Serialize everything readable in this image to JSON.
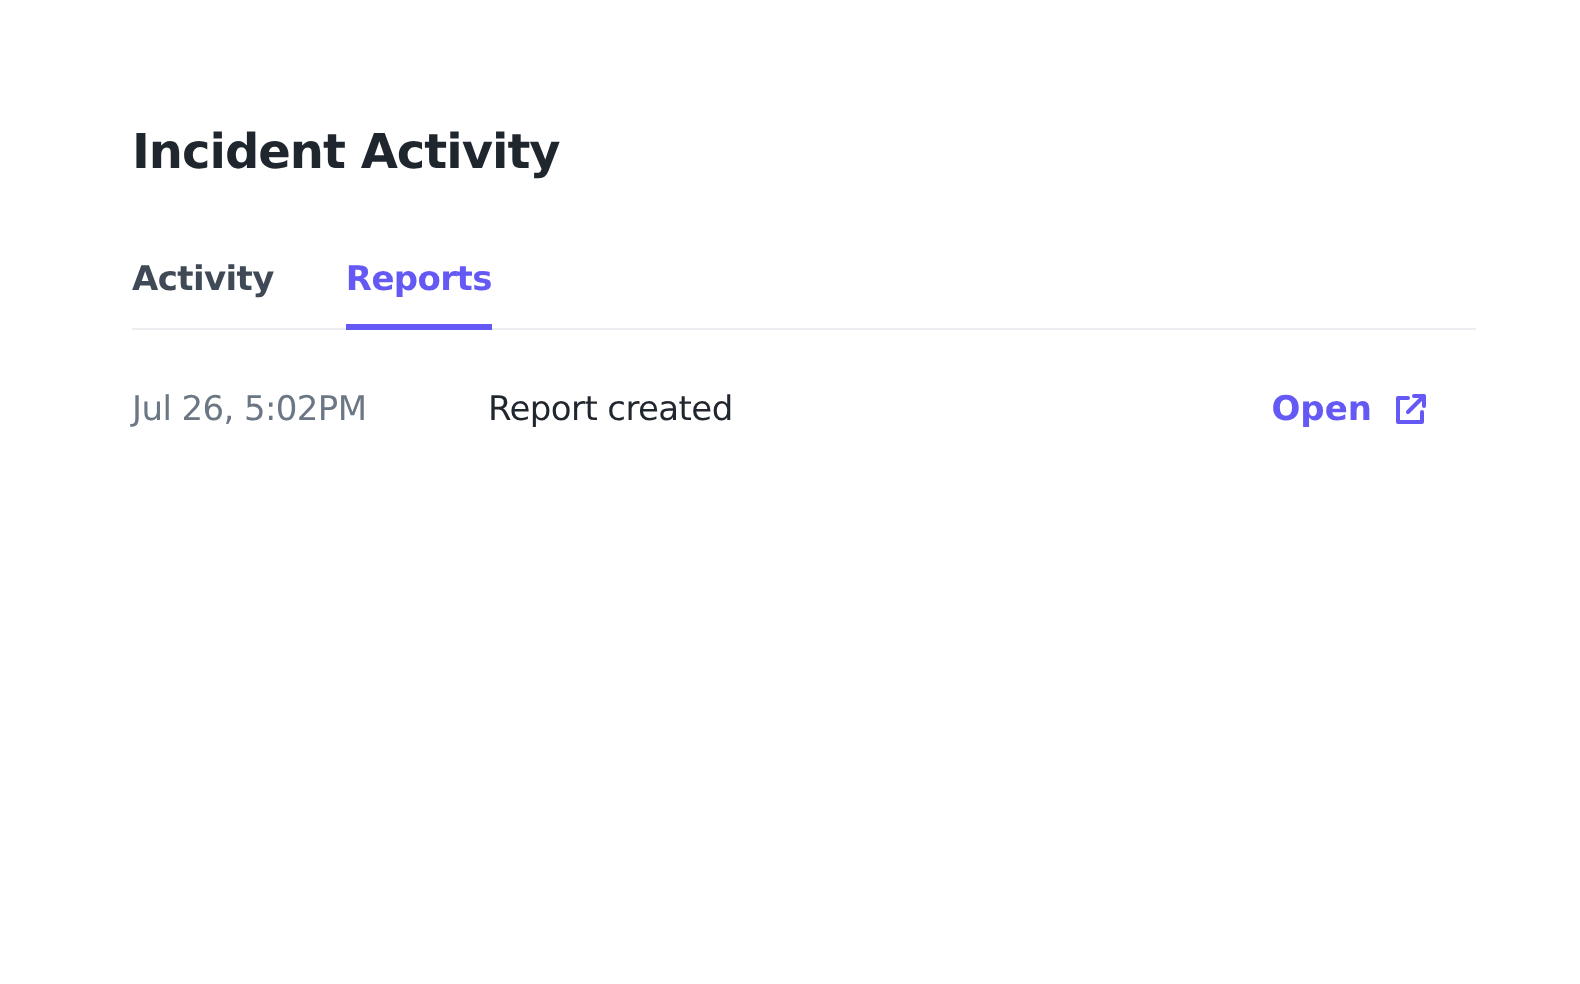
{
  "title": "Incident Activity",
  "tabs": [
    {
      "label": "Activity",
      "selected": false
    },
    {
      "label": "Reports",
      "selected": true
    }
  ],
  "reports": [
    {
      "time": "Jul 26, 5:02PM",
      "description": "Report created",
      "action": "Open"
    }
  ]
}
